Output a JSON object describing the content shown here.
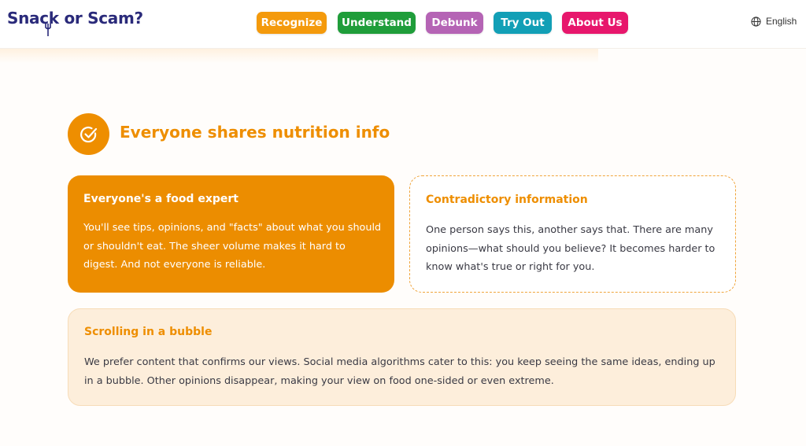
{
  "header": {
    "logo_text": "Snack or Scam?",
    "nav": [
      {
        "label": "Recognize",
        "color": "#f49a0c"
      },
      {
        "label": "Understand",
        "color": "#1f9d3a"
      },
      {
        "label": "Debunk",
        "color": "#b564b5"
      },
      {
        "label": "Try Out",
        "color": "#129fb6"
      },
      {
        "label": "About Us",
        "color": "#e7176c"
      }
    ],
    "language": "English"
  },
  "section": {
    "title": "Everyone shares nutrition info",
    "icon": "check-circle-icon",
    "accent": "#ee8e00"
  },
  "cards": [
    {
      "title": "Everyone's a food expert",
      "body": "You'll see tips, opinions, and \"facts\" about what you should or shouldn't eat. The sheer volume makes it hard to digest. And not everyone is reliable."
    },
    {
      "title": "Contradictory information",
      "body": "One person says this, another says that. There are many opinions—what should you believe? It becomes harder to know what's true or right for you."
    },
    {
      "title": "Scrolling in a bubble",
      "body": "We prefer content that confirms our views. Social media algorithms cater to this: you keep seeing the same ideas, ending up in a bubble. Other opinions disappear, making your view on food one-sided or even extreme."
    }
  ]
}
